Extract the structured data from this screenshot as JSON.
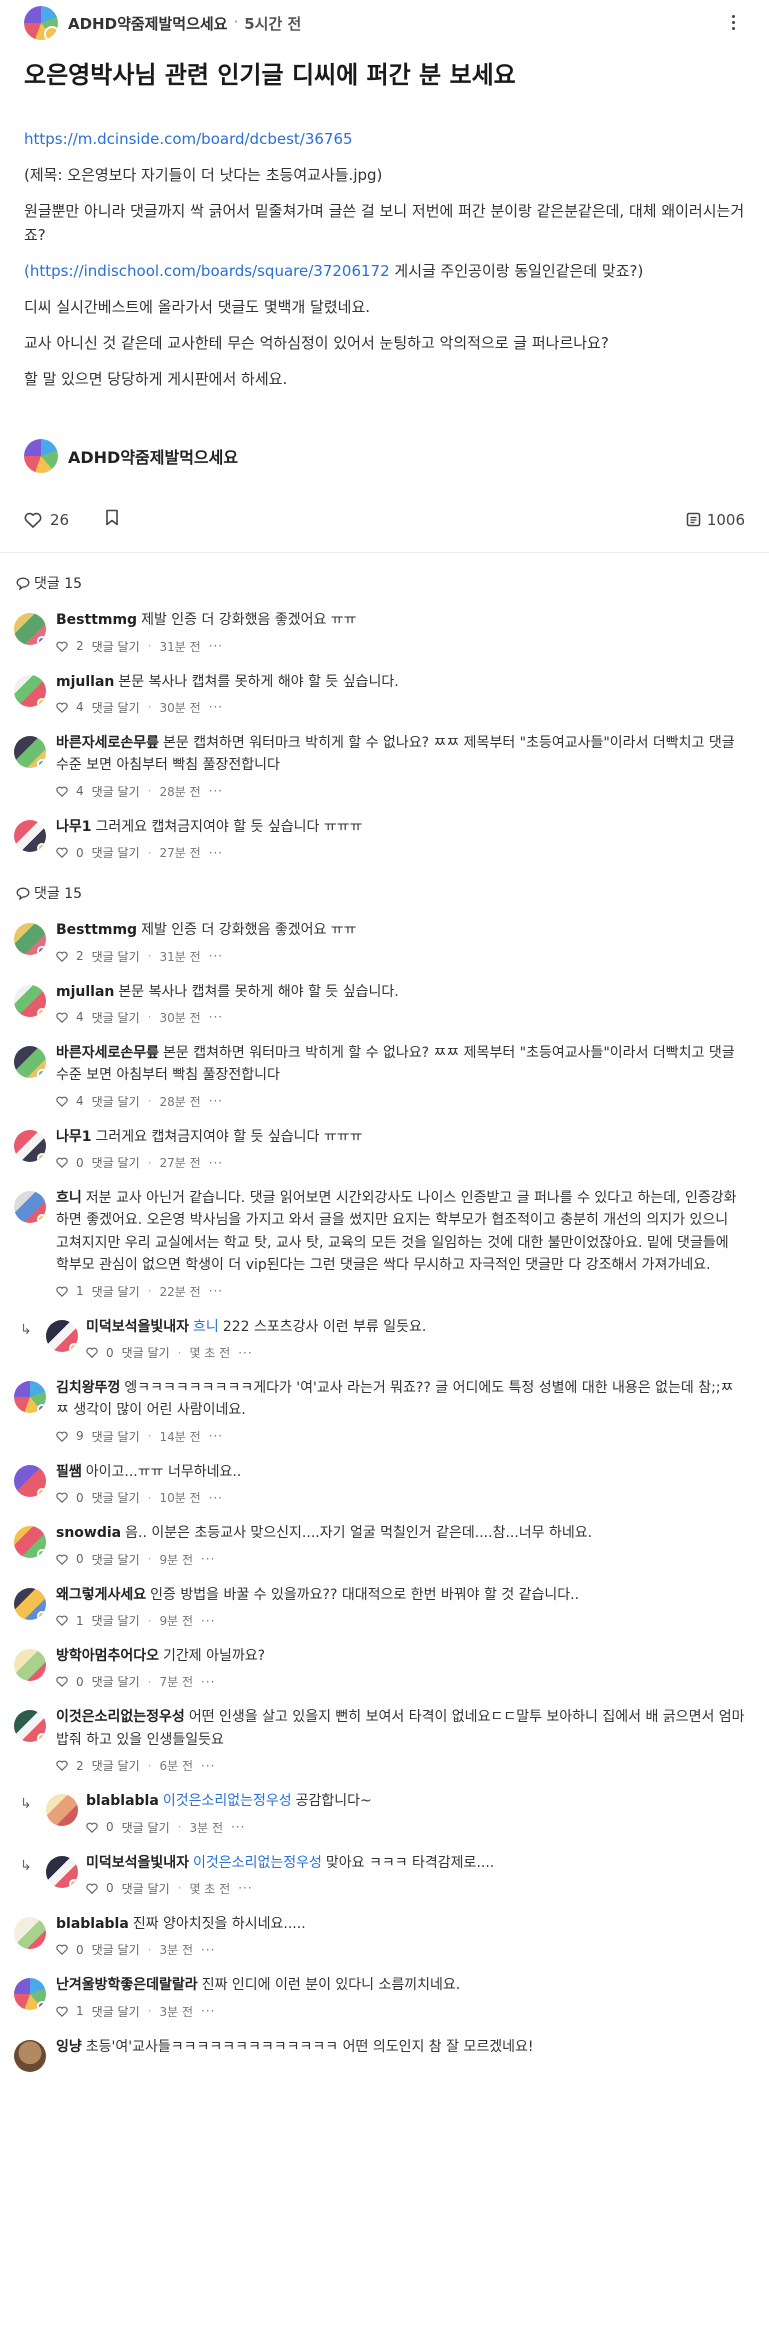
{
  "header": {
    "board": "ADHD약줌제발먹으세요",
    "dot": "·",
    "time": "5시간 전"
  },
  "post": {
    "title": "오은영박사님 관련 인기글 디씨에 퍼간 분 보세요",
    "link": "https://m.dcinside.com/board/dcbest/36765",
    "line1": "(제목: 오은영보다 자기들이 더 낫다는 초등여교사들.jpg)",
    "line2": "원글뿐만 아니라 댓글까지 싹 긁어서 밑줄쳐가며 글쓴 걸 보니 저번에 퍼간 분이랑 같은분같은데, 대체 왜이러시는거죠?",
    "line3_link": "(https://indischool.com/boards/square/37206172",
    "line3_rest": " 게시글 주인공이랑 동일인같은데 맞죠?)",
    "line4": "디씨 실시간베스트에 올라가서 댓글도 몇백개 달렸네요.",
    "line5": "교사 아니신 것 같은데 교사한테 무슨 억하심정이 있어서 눈팅하고 악의적으로 글 퍼나르나요?",
    "line6": "할 말 있으면 당당하게 게시판에서 하세요.",
    "author": "ADHD약줌제발먹으세요",
    "likes": "26",
    "views": "1006"
  },
  "comment_header_label": "댓글 15",
  "ui": {
    "reply_label": "댓글 달기",
    "sep": "·",
    "more": "···",
    "reply_arrow": "↳"
  },
  "comments_a": [
    {
      "nick": "Besttmmg",
      "text": "제발 인증 더 강화했음 좋겠어요 ㅠㅠ",
      "likes": "2",
      "ago": "31분 전"
    },
    {
      "nick": "mjullan",
      "text": "본문 복사나 캡쳐를 못하게 해야 할 듯 싶습니다.",
      "likes": "4",
      "ago": "30분 전"
    },
    {
      "nick": "바른자세로손무릎",
      "text": "본문 캡쳐하면 워터마크 박히게 할 수 없나요? ㅉㅉ 제목부터 \"초등여교사들\"이라서 더빡치고 댓글 수준 보면 아침부터 빡침 풀장전합니다",
      "likes": "4",
      "ago": "28분 전"
    },
    {
      "nick": "나무1",
      "text": "그러게요 캡쳐금지여야 할 듯 싶습니다 ㅠㅠㅠ",
      "likes": "0",
      "ago": "27분 전"
    }
  ],
  "comments_b": [
    {
      "nick": "Besttmmg",
      "text": "제발 인증 더 강화했음 좋겠어요 ㅠㅠ",
      "likes": "2",
      "ago": "31분 전"
    },
    {
      "nick": "mjullan",
      "text": "본문 복사나 캡쳐를 못하게 해야 할 듯 싶습니다.",
      "likes": "4",
      "ago": "30분 전"
    },
    {
      "nick": "바른자세로손무릎",
      "text": "본문 캡쳐하면 워터마크 박히게 할 수 없나요? ㅉㅉ 제목부터 \"초등여교사들\"이라서 더빡치고 댓글 수준 보면 아침부터 빡침 풀장전합니다",
      "likes": "4",
      "ago": "28분 전"
    },
    {
      "nick": "나무1",
      "text": "그러게요 캡쳐금지여야 할 듯 싶습니다 ㅠㅠㅠ",
      "likes": "0",
      "ago": "27분 전"
    },
    {
      "nick": "흐니",
      "text": "저분 교사 아닌거 같습니다. 댓글 읽어보면 시간외강사도 나이스 인증받고 글 퍼나를 수 있다고 하는데, 인증강화 하면 좋겠어요. 오은영 박사님을 가지고 와서 글을 썼지만 요지는 학부모가 협조적이고 충분히 개선의 의지가 있으니 고쳐지지만 우리 교실에서는 학교 탓, 교사 탓, 교육의 모든 것을 일임하는 것에 대한 불만이었잖아요. 밑에 댓글들에 학부모 관심이 없으면 학생이 더 vip된다는 그런 댓글은 싹다 무시하고 자극적인 댓글만 다 강조해서 가져가네요.",
      "likes": "1",
      "ago": "22분 전"
    },
    {
      "nick": "미덕보석을빛내자",
      "mention": "흐니",
      "text": "222 스포츠강사 이런 부류 일듯요.",
      "likes": "0",
      "ago": "몇 초 전"
    },
    {
      "nick": "김치왕뚜껑",
      "text": "엥ㅋㅋㅋㅋㅋㅋㅋㅋㅋ게다가 '여'교사 라는거 뭐죠?? 글 어디에도 특정 성별에 대한 내용은 없는데 참;;ㅉㅉ 생각이 많이 어린 사람이네요.",
      "likes": "9",
      "ago": "14분 전"
    },
    {
      "nick": "필쌤",
      "text": "아이고...ㅠㅠ 너무하네요..",
      "likes": "0",
      "ago": "10분 전"
    },
    {
      "nick": "snowdia",
      "text": "음.. 이분은 초등교사 맞으신지....자기 얼굴 먹칠인거 같은데....참...너무 하네요.",
      "likes": "0",
      "ago": "9분 전"
    },
    {
      "nick": "왜그렇게사세요",
      "text": "인증 방법을 바꿀 수 있을까요?? 대대적으로 한번 바꿔야 할 것 같습니다..",
      "likes": "1",
      "ago": "9분 전"
    },
    {
      "nick": "방학아멈추어다오",
      "text": "기간제 아닐까요?",
      "likes": "0",
      "ago": "7분 전"
    },
    {
      "nick": "이것은소리없는정우성",
      "text": "어떤 인생을 살고 있을지 뻔히 보여서 타격이 없네요ㄷㄷ말투 보아하니 집에서 배 긁으면서 엄마 밥줘 하고 있을 인생들일듯요",
      "likes": "2",
      "ago": "6분 전"
    },
    {
      "nick": "blablabla",
      "mention": "이것은소리없는정우성",
      "text": "공감합니다~",
      "likes": "0",
      "ago": "3분 전"
    },
    {
      "nick": "미덕보석을빛내자",
      "mention": "이것은소리없는정우성",
      "text": "맞아요 ㅋㅋㅋ 타격감제로....",
      "likes": "0",
      "ago": "몇 초 전"
    },
    {
      "nick": "blablabla",
      "text": "진짜 양아치짓을 하시네요.....",
      "likes": "0",
      "ago": "3분 전"
    },
    {
      "nick": "난겨울방학좋은데랄랄라",
      "text": "진짜 인디에 이런 분이 있다니 소름끼치네요.",
      "likes": "1",
      "ago": "3분 전"
    },
    {
      "nick": "잉냥",
      "text": "초등'여'교사들ㅋㅋㅋㅋㅋㅋㅋㅋㅋㅋㅋㅋㅋ 어떤 의도인지 참 잘 모르겠네요!"
    }
  ]
}
